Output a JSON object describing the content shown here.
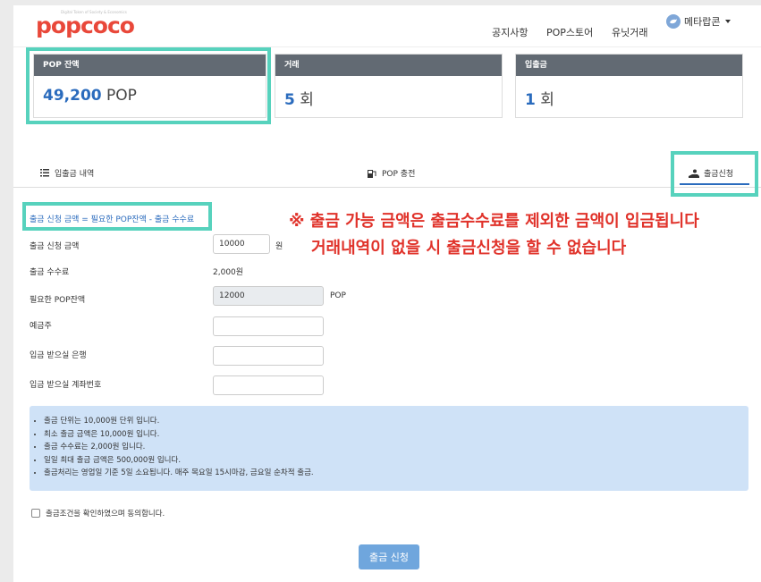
{
  "header": {
    "logo_tagline": "Digital Token of Society & Economics",
    "logo_text": "popcoco",
    "nav": [
      "공지사항",
      "POP스토어",
      "유닛거래"
    ],
    "user_name": "메타랍콘"
  },
  "stats": [
    {
      "label": "POP 잔액",
      "value": "49,200",
      "unit": "POP"
    },
    {
      "label": "거래",
      "value": "5",
      "unit": "회"
    },
    {
      "label": "입출금",
      "value": "1",
      "unit": "회"
    }
  ],
  "tabs": {
    "history": "입출금 내역",
    "charge": "POP 충전",
    "withdraw": "출금신청"
  },
  "form": {
    "formula": "출금 신청 금액 = 필요한 POP잔액 - 출금 수수료",
    "warning_line1": "※ 출금 가능 금액은 출금수수료를 제외한 금액이 입금됩니다",
    "warning_line2": "거래내역이 없을 시 출금신청을 할 수 없습니다",
    "amount_label": "출금 신청 금액",
    "amount_value": "10000",
    "amount_unit": "원",
    "fee_label": "출금 수수료",
    "fee_value": "2,000원",
    "required_label": "필요한 POP잔액",
    "required_value": "12000",
    "required_unit": "POP",
    "holder_label": "예금주",
    "bank_label": "입금 받으실 은행",
    "account_label": "입금 받으실 계좌번호"
  },
  "notice": [
    "출금 단위는 10,000원 단위 입니다.",
    "최소 출금 금액은 10,000원 입니다.",
    "출금 수수료는 2,000원 입니다.",
    "일일 최대 출금 금액은 500,000원 입니다.",
    "출금처리는 영업일 기준 5일 소요됩니다. 매주 목요일 15시마감, 금요일 순차적 출금."
  ],
  "agree_label": "출금조건을 확인하였으며 동의합니다.",
  "submit_label": "출금 신청",
  "colors": {
    "brand": "#e9483a",
    "accent": "#2a6bbd",
    "highlight": "#57d2bd",
    "warning": "#e0322a"
  }
}
